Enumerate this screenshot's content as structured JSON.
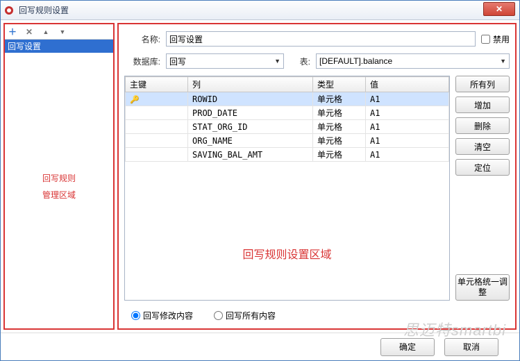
{
  "window": {
    "title": "回写规则设置"
  },
  "toolbar": {
    "add": "＋",
    "del": "✕",
    "up": "▲",
    "down": "▼"
  },
  "tree": {
    "selected": "回写设置"
  },
  "left_area": {
    "line1": "回写规则",
    "line2": "管理区域"
  },
  "form": {
    "name_label": "名称:",
    "name_value": "回写设置",
    "disable_label": "禁用",
    "db_label": "数据库:",
    "db_value": "回写",
    "table_label": "表:",
    "table_value": "[DEFAULT].balance"
  },
  "grid": {
    "headers": {
      "pk": "主键",
      "col": "列",
      "type": "类型",
      "val": "值"
    },
    "rows": [
      {
        "pk_icon": "🔑",
        "col": "ROWID",
        "type": "单元格",
        "val": "A1",
        "selected": true
      },
      {
        "pk_icon": "",
        "col": "PROD_DATE",
        "type": "单元格",
        "val": "A1"
      },
      {
        "pk_icon": "",
        "col": "STAT_ORG_ID",
        "type": "单元格",
        "val": "A1"
      },
      {
        "pk_icon": "",
        "col": "ORG_NAME",
        "type": "单元格",
        "val": "A1"
      },
      {
        "pk_icon": "",
        "col": "SAVING_BAL_AMT",
        "type": "单元格",
        "val": "A1"
      }
    ],
    "center_label": "回写规则设置区域"
  },
  "sidebtns": {
    "all_cols": "所有列",
    "add": "增加",
    "delete": "删除",
    "clear": "清空",
    "locate": "定位",
    "merge": "单元格统一调整"
  },
  "radios": {
    "mode_modify": "回写修改内容",
    "mode_all": "回写所有内容",
    "selected": "mode_modify"
  },
  "footer": {
    "ok": "确定",
    "cancel": "取消"
  },
  "watermark": "思迈特smartbi"
}
